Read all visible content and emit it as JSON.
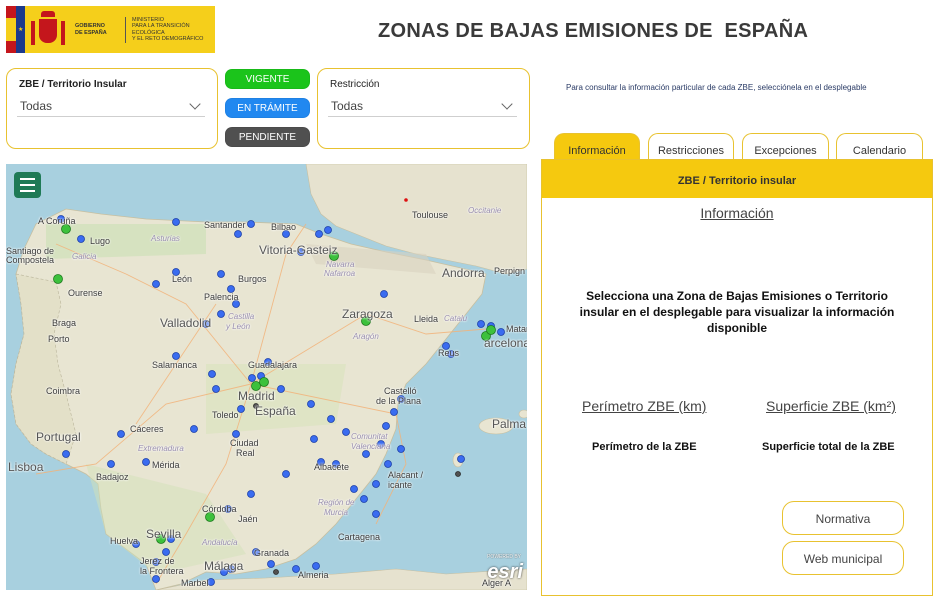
{
  "header": {
    "gov_line1": "GOBIERNO",
    "gov_line2": "DE ESPAÑA",
    "min_line1": "MINISTERIO",
    "min_line2": "PARA LA TRANSICIÓN ECOLÓGICA",
    "min_line3": "Y EL RETO DEMOGRÁFICO",
    "title": "ZONAS DE BAJAS EMISIONES DE  ESPAÑA"
  },
  "filters": {
    "zbe_label": "ZBE / Territorio Insular",
    "zbe_value": "Todas",
    "restr_label": "Restricción",
    "restr_value": "Todas"
  },
  "status_buttons": {
    "vigente": "VIGENTE",
    "tramite": "EN TRÁMITE",
    "pendiente": "PENDIENTE"
  },
  "note": "Para consultar la información particular de cada ZBE, selecciónela en el desplegable",
  "tabs": [
    {
      "label": "Información",
      "active": true
    },
    {
      "label": "Restricciones",
      "active": false
    },
    {
      "label": "Excepciones",
      "active": false
    },
    {
      "label": "Calendario",
      "active": false
    }
  ],
  "panel": {
    "header": "ZBE / Territorio insular",
    "subtitle": "Información",
    "message": "Selecciona una Zona de Bajas Emisiones o Territorio insular en el desplegable para visualizar la información disponible",
    "perimeter_label": "Perímetro ZBE (km)",
    "surface_label": "Superficie ZBE (km²)",
    "perimeter_value": "Perímetro de la ZBE",
    "surface_value": "Superficie total de la ZBE",
    "normativa": "Normativa",
    "web": "Web municipal"
  },
  "map": {
    "labels": {
      "coruna": "A Coruña",
      "lugo": "Lugo",
      "santiago": "Santiago de Compostela",
      "galicia": "Galicia",
      "ourense": "Ourense",
      "asturias": "Asturias",
      "santander": "Santander",
      "bilbao": "Bilbao",
      "vitoria": "Vitoria-Gasteiz",
      "navarra": "Navarra",
      "nafarroa": "Nafarroa",
      "toulouse": "Toulouse",
      "occitanie": "Occitanie",
      "andorra": "Andorra",
      "perpignan": "Perpign",
      "leon": "León",
      "burgos": "Burgos",
      "braga": "Braga",
      "porto": "Porto",
      "palencia": "Palencia",
      "valladolid": "Valladolid",
      "castilla": "Castilla",
      "yleon": "y León",
      "zaragoza": "Zaragoza",
      "aragon": "Aragón",
      "lleida": "Lleida",
      "catalunya": "Catalu",
      "mataro": "Matar",
      "barcelona": "arcelona",
      "reus": "Reus",
      "salamanca": "Salamanca",
      "guadalajara": "Guadalajara",
      "madrid": "Madrid",
      "espana": "España",
      "toledo": "Toledo",
      "coimbra": "Coimbra",
      "portugal": "Portugal",
      "caceres": "Cáceres",
      "extremadura": "Extremadura",
      "ciudad": "Ciudad",
      "real": "Real",
      "castellon": "Castelló",
      "delaplana": "de la Plana",
      "comunitat": "Comunitat",
      "valenciana": "Valenciana",
      "palma": "Palma",
      "lisboa": "Lisboa",
      "badajoz": "Badajoz",
      "merida": "Mérida",
      "albacete": "Albacete",
      "alacant": "Alacant /",
      "alicante": "icante",
      "regionde": "Región de",
      "murcia": "Murcia",
      "cordoba": "Córdoba",
      "jaen": "Jaén",
      "cartagena": "Cartagena",
      "sevilla": "Sevilla",
      "huelva": "Huelva",
      "andalucia": "Andalucía",
      "granada": "Granada",
      "jerezde": "Jerez de",
      "frontera": "la Frontera",
      "malaga": "Málaga",
      "marbella": "Marbel",
      "almeria": "Almeria",
      "alger": "Alger A",
      "esri": "esri",
      "powered": "POWERED BY"
    }
  },
  "colors": {
    "accent": "#f5c90f",
    "vigente": "#1bc41b",
    "tramite": "#2188f0",
    "pendiente": "#505050",
    "dot_blue": "#3a6cf0",
    "dot_green": "#2fa82f"
  }
}
